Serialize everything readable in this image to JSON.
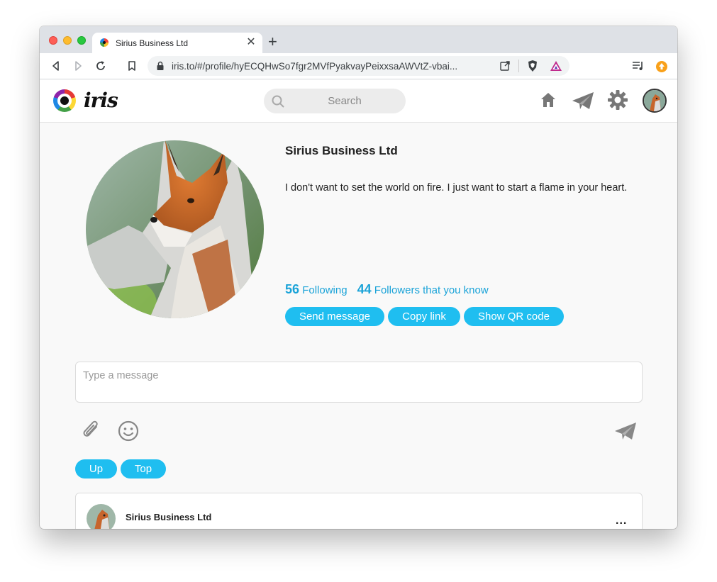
{
  "browser": {
    "tab_title": "Sirius Business Ltd",
    "tab_close": "✕",
    "new_tab": "+",
    "url": "iris.to/#/profile/hyECQHwSo7fgr2MVfPyakvayPeixxsaAWVtZ-vbai..."
  },
  "app": {
    "logo_text": "iris",
    "search_placeholder": "Search"
  },
  "profile": {
    "name": "Sirius Business Ltd",
    "bio": "I don't want to set the world on fire. I just want to start a flame in your heart.",
    "following_count": "56",
    "following_label": "Following",
    "followers_count": "44",
    "followers_label": "Followers that you know"
  },
  "actions": {
    "send_message": "Send message",
    "copy_link": "Copy link",
    "show_qr": "Show QR code"
  },
  "composer": {
    "placeholder": "Type a message"
  },
  "feed_nav": {
    "up": "Up",
    "top": "Top"
  },
  "post": {
    "author": "Sirius Business Ltd",
    "more": "..."
  },
  "colors": {
    "accent": "#1fbef0",
    "link": "#1aa3d8"
  },
  "icons": [
    "back-icon",
    "forward-icon",
    "reload-icon",
    "bookmark-icon",
    "lock-icon",
    "share-icon",
    "brave-shield-icon",
    "brave-rewards-icon",
    "playlist-icon",
    "update-icon",
    "search-icon",
    "home-icon",
    "paper-plane-icon",
    "gear-icon",
    "paperclip-icon",
    "smiley-icon",
    "send-icon"
  ]
}
